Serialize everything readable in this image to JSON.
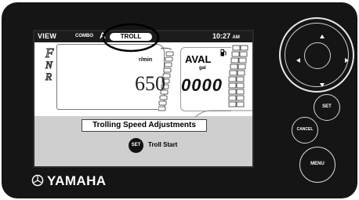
{
  "header": {
    "mode": "VIEW",
    "combo_label": "COMBO",
    "combo_letter": "A",
    "troll_label": "TROLL",
    "time": "10:27",
    "ampm": "AM"
  },
  "gears": [
    "F",
    "N",
    "R"
  ],
  "tach": {
    "unit": "r/min",
    "value": "650"
  },
  "fuel": {
    "label": "AVAL",
    "unit": "gal",
    "value": "0000"
  },
  "troll_panel": {
    "title": "Trolling Speed Adjustments",
    "set_label": "SET",
    "action": "Troll Start"
  },
  "controls": {
    "set": "SET",
    "cancel": "CANCEL",
    "menu": "MENU"
  },
  "brand": "YAMAHA",
  "colors": {
    "bezel": "#151515",
    "screen_bg": "#ffffff",
    "panel_bg": "#cfcfcf",
    "highlight_circle": "#000000"
  }
}
